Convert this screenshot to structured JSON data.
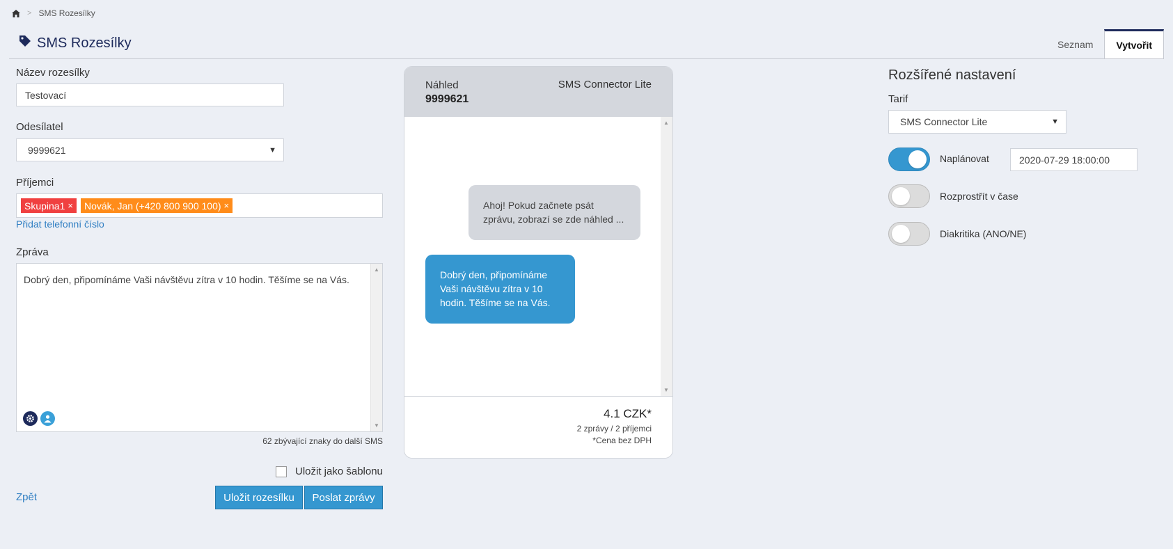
{
  "breadcrumb": {
    "home_icon": "home-icon",
    "separator": ">",
    "current": "SMS Rozesílky"
  },
  "header": {
    "title": "SMS Rozesílky",
    "title_icon": "tag-icon"
  },
  "tabs": [
    {
      "label": "Seznam"
    },
    {
      "label": "Vytvořit"
    }
  ],
  "form": {
    "name_label": "Název rozesílky",
    "name_value": "Testovací",
    "sender_label": "Odesílatel",
    "sender_value": "9999621",
    "recipients_label": "Příjemci",
    "recipients": [
      {
        "label": "Skupina1",
        "remove": "×"
      },
      {
        "label": "Novák, Jan (+420 800 900 100)",
        "remove": "×"
      }
    ],
    "add_phone_link": "Přidat telefonní číslo",
    "message_label": "Zpráva",
    "message_value": "Dobrý den, připomínáme Vaši návštěvu zítra v 10 hodin. Těšíme se na Vás.",
    "char_count": "62 zbývající znaky do další SMS",
    "save_template_label": "Uložit jako šablonu",
    "back_link": "Zpět",
    "save_button": "Uložit rozesílku",
    "send_button": "Poslat zprávy"
  },
  "preview": {
    "title": "Náhled",
    "number": "9999621",
    "tariff": "SMS Connector Lite",
    "incoming_text": "Ahoj! Pokud začnete psát zprávu, zobrazí se zde náhled ...",
    "outgoing_text": "Dobrý den, připomínáme Vaši návštěvu zítra v 10 hodin. Těšíme se na Vás.",
    "price": "4.1 CZK*",
    "price_detail": "2 zprávy / 2 příjemci",
    "price_note": "*Cena bez DPH"
  },
  "settings": {
    "title": "Rozšířené nastavení",
    "tariff_label": "Tarif",
    "tariff_value": "SMS Connector Lite",
    "schedule_label": "Naplánovat",
    "schedule_on": true,
    "schedule_value": "2020-07-29 18:00:00",
    "spread_label": "Rozprostřít v čase",
    "spread_on": false,
    "diacritics_label": "Diakritika (ANO/NE)",
    "diacritics_on": false
  },
  "colors": {
    "primary": "#3597d0",
    "navy": "#1d2a5b",
    "tag_red": "#f04040",
    "tag_orange": "#ff8c1a"
  }
}
